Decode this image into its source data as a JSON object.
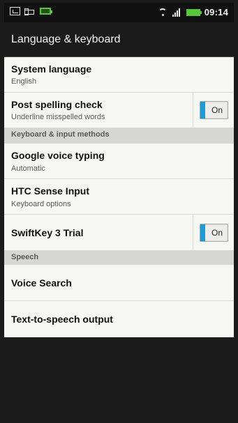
{
  "status_bar": {
    "time": "09:14",
    "icons": [
      "screenshot-icon",
      "usb-icon",
      "battery-icon",
      "wifi-icon",
      "signal-icon",
      "battery-icon"
    ],
    "battery_color": "#58c63a"
  },
  "header": {
    "title": "Language & keyboard"
  },
  "settings": {
    "system_language": {
      "title": "System language",
      "subtitle": "English"
    },
    "post_spelling_check": {
      "title": "Post spelling check",
      "subtitle": "Underline misspelled words",
      "toggle": "On"
    },
    "keyboard_section": "Keyboard & input methods",
    "google_voice_typing": {
      "title": "Google voice typing",
      "subtitle": "Automatic"
    },
    "htc_sense_input": {
      "title": "HTC Sense Input",
      "subtitle": "Keyboard options"
    },
    "swiftkey": {
      "title": "SwiftKey 3 Trial",
      "toggle": "On"
    },
    "speech_section": "Speech",
    "voice_search": {
      "title": "Voice Search"
    },
    "text_to_speech": {
      "title": "Text-to-speech output"
    }
  },
  "colors": {
    "accent": "#1e9ad7",
    "list_background": "#f6f6f2",
    "section_background": "#d6d6d3",
    "dark_background": "#1b1b1b"
  }
}
